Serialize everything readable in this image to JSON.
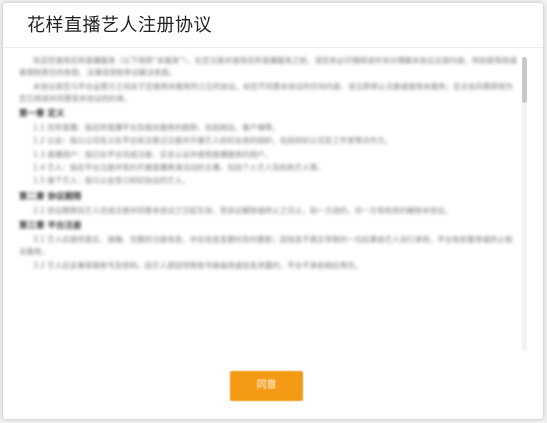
{
  "dialog": {
    "title": "花样直播艺人注册协议",
    "agree_label": "同意"
  },
  "agreement": {
    "blocks": [
      {
        "type": "para",
        "text": "欢迎您使用花样直播服务（以下简称“本服务”），在您注册并使用花样直播服务之前，请您务必仔细阅读并充分理解本协议全部内容，特别是免除或者限制责任的条款、法律适用和争议解决条款。"
      },
      {
        "type": "para",
        "text": "本协议是您与平台运营方之间关于您使用本服务所订立的协议。如您不同意本协议的任何内容，请立即停止注册或使用本服务；您点击同意即视为您已阅读并同意受本协议的约束。"
      },
      {
        "type": "head",
        "text": "第一章 定义"
      },
      {
        "type": "para",
        "text": "1.1 花样直播：指花样直播平台及相关服务的统称，包括网站、客户端等。"
      },
      {
        "type": "para",
        "text": "1.2 公会：指以公司名义在平台依法登记注册并开展艺人经纪业务的组织，包括经纪公司及工作室等合作方。"
      },
      {
        "type": "para",
        "text": "1.3 直播用户：指已在平台完成注册、实名认证并使用直播服务的用户。"
      },
      {
        "type": "para",
        "text": "1.4 艺人：指在平台注册并签约开展直播表演活动的主播，包括个人艺人及机构艺人等。"
      },
      {
        "type": "para",
        "text": "1.5 旗下艺人：指与公会签订经纪协议的艺人。"
      },
      {
        "type": "head",
        "text": "第二章 协议期限"
      },
      {
        "type": "para",
        "text": "2.1 协议期限自艺人完成注册并同意本协议之日起生效，至协议解除或终止之日止。如一方违约，另一方有权依约解除本协议。"
      },
      {
        "type": "head",
        "text": "第三章 平台注册"
      },
      {
        "type": "para",
        "text": "3.1 艺人应提供真实、准确、完整的注册信息，并在信息变更时及时更新；因信息不真实导致的一切后果由艺人自行承担，平台有权暂停或终止相关服务。"
      },
      {
        "type": "para",
        "text": "3.2 艺人应妥善保管账号及密码，因艺人原因导致账号被盗用或信息泄露的，平台不承担相应责任。"
      }
    ]
  }
}
